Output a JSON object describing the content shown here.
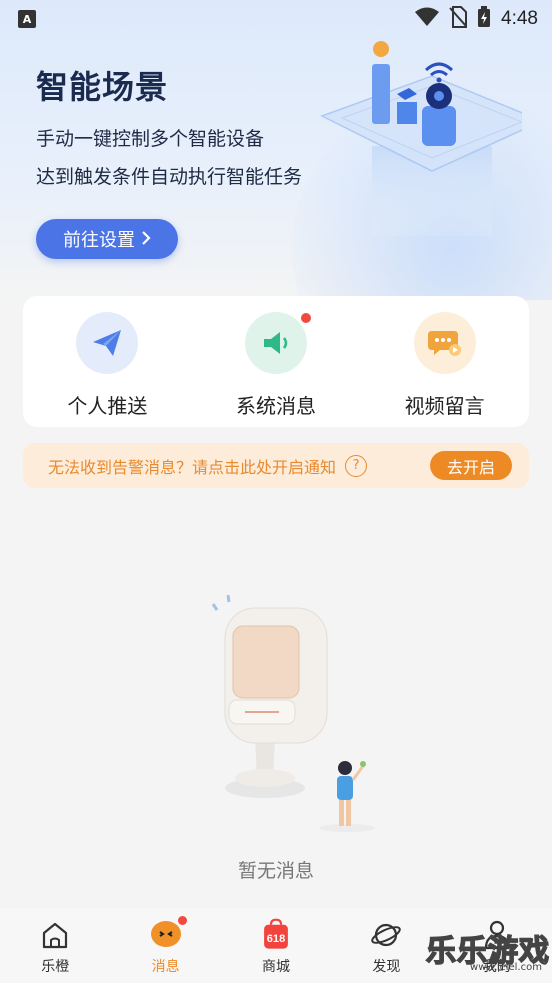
{
  "status_bar": {
    "time": "4:48",
    "app_badge": "A"
  },
  "hero": {
    "title": "智能场景",
    "line1": "手动一键控制多个智能设备",
    "line2": "达到触发条件自动执行智能任务",
    "button_label": "前往设置"
  },
  "quick_actions": [
    {
      "label": "个人推送",
      "icon": "paper-plane-icon",
      "has_badge": false
    },
    {
      "label": "系统消息",
      "icon": "speaker-icon",
      "has_badge": true
    },
    {
      "label": "视频留言",
      "icon": "chat-bubble-icon",
      "has_badge": false
    }
  ],
  "notice": {
    "text": "无法收到告警消息？请点击此处开启通知",
    "help_glyph": "?",
    "button_label": "去开启"
  },
  "empty_state": {
    "text": "暂无消息"
  },
  "tabbar": {
    "tabs": [
      {
        "label": "乐橙",
        "icon": "home-icon",
        "active": false
      },
      {
        "label": "消息",
        "icon": "message-icon",
        "active": true,
        "badge": true
      },
      {
        "label": "商城",
        "icon": "shopping-bag-618-icon",
        "active": false,
        "icon_text": "618"
      },
      {
        "label": "发现",
        "icon": "planet-icon",
        "active": false
      },
      {
        "label": "我的",
        "icon": "profile-icon",
        "active": false
      }
    ]
  },
  "watermark": {
    "title": "乐乐游戏",
    "url": "www.lelel.com"
  },
  "colors": {
    "accent_blue": "#4b74e6",
    "accent_orange": "#ee8a24",
    "notice_bg": "#fdecd9",
    "badge_red": "#f04a3e"
  }
}
